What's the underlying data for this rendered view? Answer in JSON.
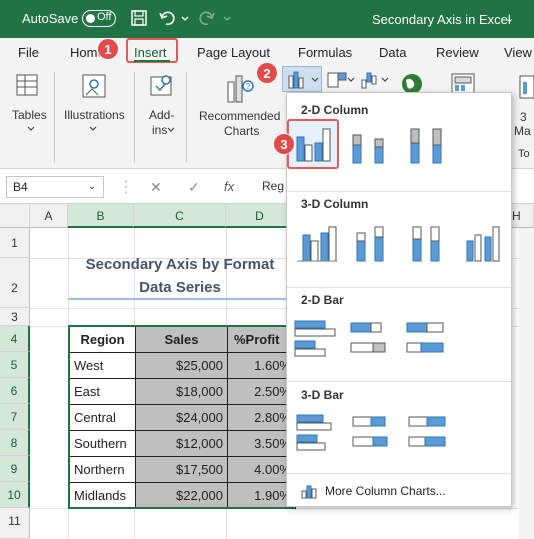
{
  "titlebar": {
    "autosave_label": "AutoSave",
    "toggle_state": "Off",
    "doc_title": "Secondary Axis in Excel",
    "colors": {
      "bg": "#217346",
      "fg": "#ffffff"
    }
  },
  "menu": {
    "items": [
      "File",
      "Home",
      "Insert",
      "Page Layout",
      "Formulas",
      "Data",
      "Review",
      "View"
    ],
    "active": "Insert"
  },
  "ribbon": {
    "groups": {
      "tables": "Tables",
      "illustrations": "Illustrations",
      "addins_line1": "Add-",
      "addins_line2": "ins",
      "recommended_line1": "Recommended",
      "recommended_line2": "Charts",
      "right_edge_line1": "3",
      "right_edge_line2": "Ma",
      "right_edge_line3": "To"
    }
  },
  "formula_bar": {
    "name_box": "B4",
    "fx": "fx",
    "content": "Reg"
  },
  "columns": [
    "A",
    "B",
    "C",
    "D",
    "",
    "",
    "",
    "H"
  ],
  "rows": [
    "1",
    "2",
    "3",
    "4",
    "5",
    "6",
    "7",
    "8",
    "9",
    "10",
    "11"
  ],
  "sheet": {
    "title_line1": "Secondary Axis by Format",
    "title_line2": "Data Series",
    "table": {
      "headers": [
        "Region",
        "Sales",
        "%Profit"
      ],
      "rows": [
        [
          "West",
          "$25,000",
          "1.60%"
        ],
        [
          "East",
          "$18,000",
          "2.50%"
        ],
        [
          "Central",
          "$24,000",
          "2.80%"
        ],
        [
          "Southern",
          "$12,000",
          "3.50%"
        ],
        [
          "Northern",
          "$17,500",
          "4.00%"
        ],
        [
          "Midlands",
          "$22,000",
          "1.90%"
        ]
      ]
    }
  },
  "dropdown": {
    "sections": [
      "2-D Column",
      "3-D Column",
      "2-D Bar",
      "3-D Bar"
    ],
    "more_label": "More Column Charts...",
    "selected": "clustered-column"
  },
  "badges": [
    "1",
    "2",
    "3"
  ],
  "accent": {
    "green": "#217346",
    "red": "#e24b4b",
    "blue": "#5b9bd5",
    "gray": "#a5a5a5"
  }
}
